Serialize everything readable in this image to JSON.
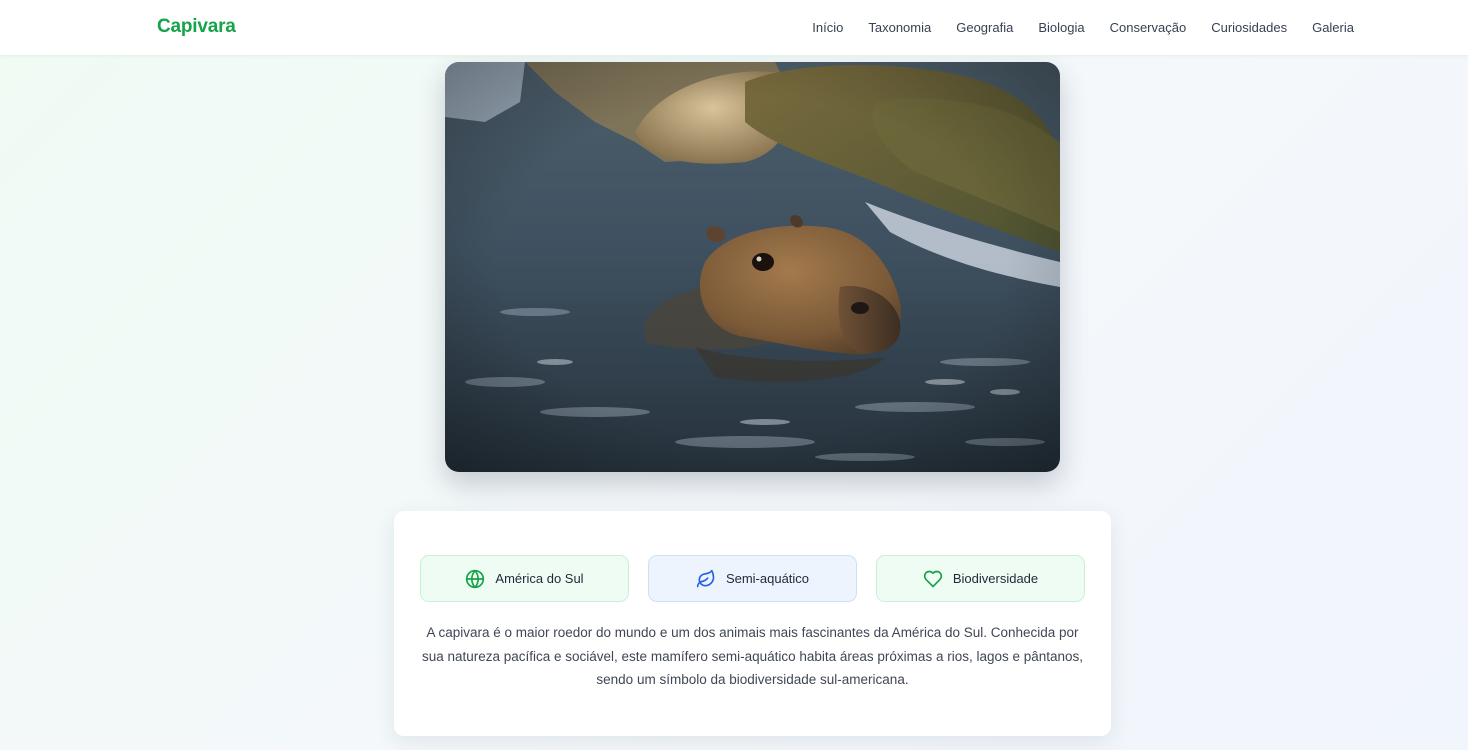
{
  "brand": {
    "name": "Capivara",
    "color": "#16a34a"
  },
  "nav": {
    "items": [
      {
        "label": "Início"
      },
      {
        "label": "Taxonomia"
      },
      {
        "label": "Geografia"
      },
      {
        "label": "Biologia"
      },
      {
        "label": "Conservação"
      },
      {
        "label": "Curiosidades"
      },
      {
        "label": "Galeria"
      }
    ]
  },
  "hero": {
    "image_subject": "capybara swimming in a river"
  },
  "features": [
    {
      "label": "América do Sul",
      "icon": "globe-icon",
      "color": "#16a34a"
    },
    {
      "label": "Semi-aquático",
      "icon": "leaf-icon",
      "color": "#2563eb"
    },
    {
      "label": "Biodiversidade",
      "icon": "heart-icon",
      "color": "#16a34a"
    }
  ],
  "description": "A capivara é o maior roedor do mundo e um dos animais mais fascinantes da América do Sul. Conhecida por sua natureza pacífica e sociável, este mamífero semi-aquático habita áreas próximas a rios, lagos e pântanos, sendo um símbolo da biodiversidade sul-americana."
}
